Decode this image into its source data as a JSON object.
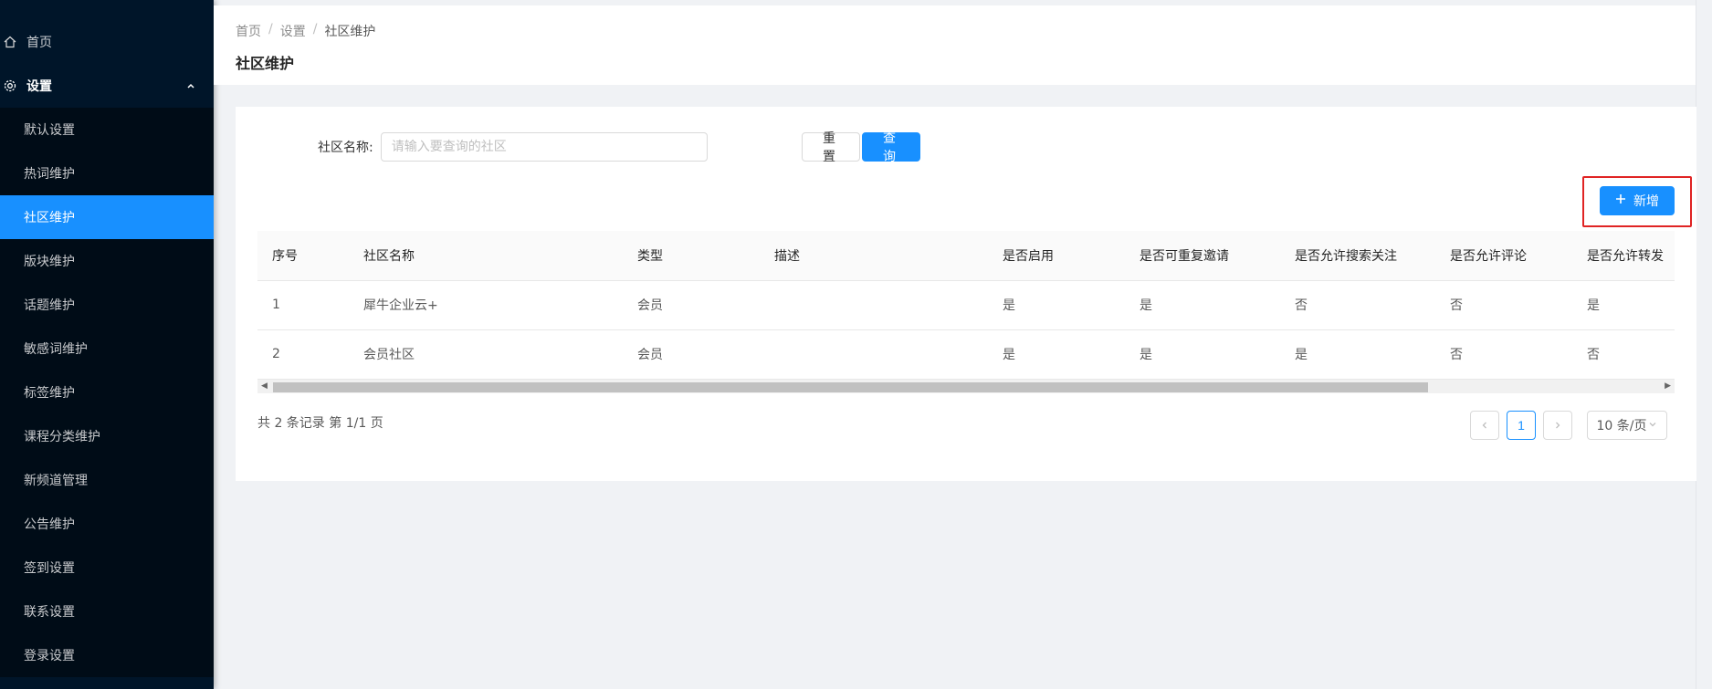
{
  "sidebar": {
    "home_label": "首页",
    "group_label": "设置",
    "items": [
      {
        "label": "默认设置"
      },
      {
        "label": "热词维护"
      },
      {
        "label": "社区维护"
      },
      {
        "label": "版块维护"
      },
      {
        "label": "话题维护"
      },
      {
        "label": "敏感词维护"
      },
      {
        "label": "标签维护"
      },
      {
        "label": "课程分类维护"
      },
      {
        "label": "新频道管理"
      },
      {
        "label": "公告维护"
      },
      {
        "label": "签到设置"
      },
      {
        "label": "联系设置"
      },
      {
        "label": "登录设置"
      }
    ]
  },
  "breadcrumb": [
    "首页",
    "设置",
    "社区维护"
  ],
  "page_title": "社区维护",
  "search": {
    "label": "社区名称:",
    "placeholder": "请输入要查询的社区",
    "value": ""
  },
  "buttons": {
    "reset": "重置",
    "query": "查询",
    "add": "新增"
  },
  "table": {
    "headers": [
      "序号",
      "社区名称",
      "类型",
      "描述",
      "是否启用",
      "是否可重复邀请",
      "是否允许搜索关注",
      "是否允许评论",
      "是否允许转发"
    ],
    "rows": [
      [
        "1",
        "犀牛企业云+",
        "会员",
        "",
        "是",
        "是",
        "否",
        "否",
        "是"
      ],
      [
        "2",
        "会员社区",
        "会员",
        "",
        "是",
        "是",
        "是",
        "否",
        "否"
      ]
    ]
  },
  "pagination": {
    "summary": "共 2 条记录 第 1/1 页",
    "current_page": "1",
    "page_size": "10 条/页"
  },
  "colors": {
    "sidebar_bg": "#001529",
    "accent": "#1890ff",
    "highlight": "#e02424"
  }
}
